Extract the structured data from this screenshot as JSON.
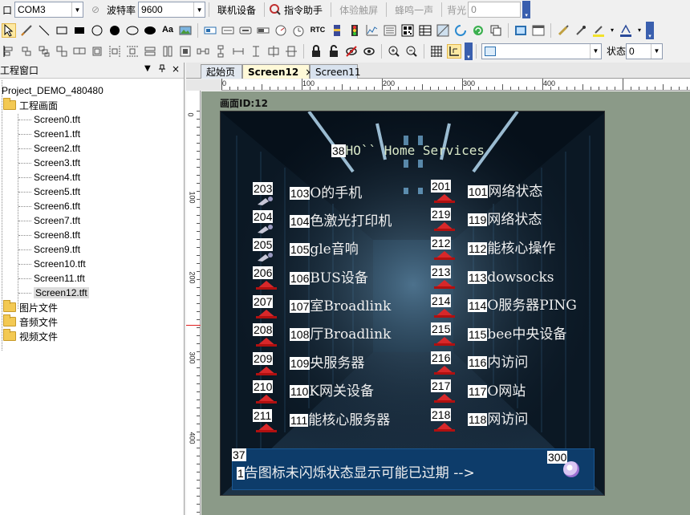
{
  "toolbar1": {
    "port_label": "口",
    "port_value": "COM3",
    "baud_label": "波特率",
    "baud_value": "9600",
    "connect": "联机设备",
    "assistant": "指令助手",
    "touch": "体验触屏",
    "buzzer": "蜂鸣一声",
    "backlight": "背光",
    "backlight_value": "0"
  },
  "toolbar3": {
    "state_label": "状态",
    "state_value": "0"
  },
  "left_panel": {
    "title": "工程窗口",
    "project": "Project_DEMO_480480",
    "group_screens": "工程画面",
    "screens": [
      "Screen0.tft",
      "Screen1.tft",
      "Screen2.tft",
      "Screen3.tft",
      "Screen4.tft",
      "Screen5.tft",
      "Screen6.tft",
      "Screen7.tft",
      "Screen8.tft",
      "Screen9.tft",
      "Screen10.tft",
      "Screen11.tft",
      "Screen12.tft"
    ],
    "group_images": "图片文件",
    "group_audio": "音频文件",
    "group_video": "视频文件"
  },
  "tabs": {
    "start": "起始页",
    "screen12": "Screen12",
    "screen11": "Screen11",
    "close": "×"
  },
  "ruler": {
    "h": [
      "0",
      "100",
      "200",
      "300",
      "400"
    ],
    "v": [
      "0",
      "100",
      "200",
      "300",
      "400"
    ]
  },
  "canvas": {
    "screen_label": "画面ID:12",
    "title_badge": "38",
    "title_text": "HO`` Home Services",
    "left_items": [
      {
        "icon_id": "203",
        "num": "103",
        "text": "O的手机"
      },
      {
        "icon_id": "204",
        "num": "104",
        "text": "色激光打印机"
      },
      {
        "icon_id": "205",
        "num": "105",
        "text": "gle音响"
      },
      {
        "icon_id": "206",
        "num": "106",
        "text": "BUS设备"
      },
      {
        "icon_id": "207",
        "num": "107",
        "text": "室Broadlink"
      },
      {
        "icon_id": "208",
        "num": "108",
        "text": "厅Broadlink"
      },
      {
        "icon_id": "209",
        "num": "109",
        "text": "央服务器"
      },
      {
        "icon_id": "210",
        "num": "110",
        "text": "K网关设备"
      },
      {
        "icon_id": "211",
        "num": "111",
        "text": "能核心服务器"
      }
    ],
    "right_items": [
      {
        "icon_id": "201",
        "num": "101",
        "text": "网络状态"
      },
      {
        "icon_id": "219",
        "num": "119",
        "text": "网络状态"
      },
      {
        "icon_id": "212",
        "num": "112",
        "text": "能核心操作"
      },
      {
        "icon_id": "213",
        "num": "113",
        "text": "dowsocks"
      },
      {
        "icon_id": "214",
        "num": "114",
        "text": "O服务器PING"
      },
      {
        "icon_id": "215",
        "num": "115",
        "text": "bee中央设备"
      },
      {
        "icon_id": "216",
        "num": "116",
        "text": "内访问"
      },
      {
        "icon_id": "217",
        "num": "117",
        "text": "O网站"
      },
      {
        "icon_id": "218",
        "num": "118",
        "text": "网访问"
      }
    ],
    "bottom_badge": "37",
    "bottom_num": "1",
    "bottom_text": "告图标未闪烁状态显示可能已过期 -->",
    "avatar_badge": "300"
  },
  "colors": {
    "accent": "#3a5fae",
    "workspace": "#8b9a88",
    "bottom_bar": "#0d3c6a",
    "icon_red": "#d8282a"
  }
}
